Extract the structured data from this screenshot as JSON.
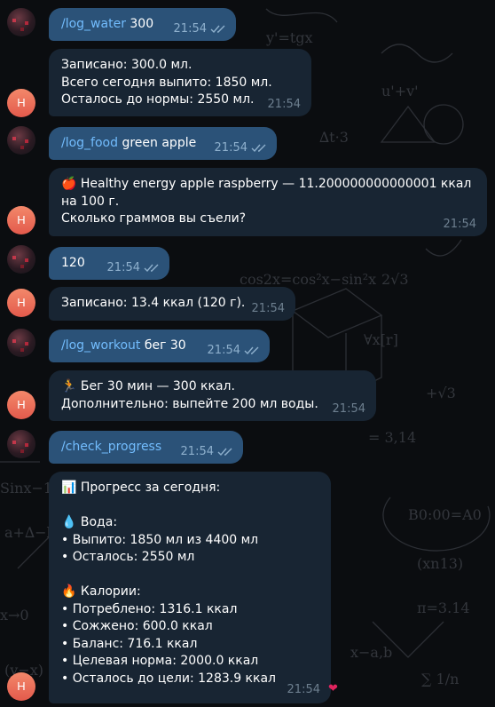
{
  "messages": {
    "m1": {
      "command": "/log_water",
      "arg": " 300",
      "time": "21:54"
    },
    "m2": {
      "lines": [
        "Записано: 300.0 мл.",
        "Всего сегодня выпито: 1850 мл.",
        "Осталось до нормы: 2550 мл."
      ],
      "time": "21:54"
    },
    "m3": {
      "command": "/log_food",
      "arg": " green apple",
      "time": "21:54"
    },
    "m4": {
      "icon": "red-apple-emoji",
      "line1": " Healthy energy apple raspberry — 11.200000000000001 ккал",
      "line2": "на 100 г.",
      "line3": "Сколько граммов вы съели?",
      "time": "21:54"
    },
    "m5": {
      "text": "120",
      "time": "21:54"
    },
    "m6": {
      "text": "Записано: 13.4 ккал (120 г).",
      "time": "21:54"
    },
    "m7": {
      "command": "/log_workout",
      "arg": " бег 30",
      "time": "21:54"
    },
    "m8": {
      "icon": "runner-emoji",
      "line1": " Бег 30 мин — 300 ккал.",
      "line2": "Дополнительно: выпейте 200 мл воды.",
      "time": "21:54"
    },
    "m9": {
      "command": "/check_progress",
      "time": "21:54"
    },
    "m10": {
      "title_icon": "bar-chart-emoji",
      "title": " Прогресс за сегодня:",
      "water_icon": "droplet-emoji",
      "water_title": " Вода:",
      "water_lines": [
        "• Выпито: 1850 мл из 4400 мл",
        "• Осталось: 2550 мл"
      ],
      "cal_icon": "fire-emoji",
      "cal_title": " Калории:",
      "cal_lines": [
        "• Потреблено: 1316.1 ккал",
        "• Сожжено: 600.0 ккал",
        "• Баланс: 716.1 ккал",
        "• Целевая норма: 2000.0 ккал",
        "• Осталось до цели: 1283.9 ккал"
      ],
      "time": "21:54",
      "reaction": "heart-reaction"
    }
  },
  "bot_avatar_letter": "Н",
  "colors": {
    "user_bubble": "#2b5278",
    "bot_bubble": "#182533",
    "command_link": "#72bcfd",
    "avatar_bot": "#e35a4c",
    "background": "#0b0d10"
  }
}
